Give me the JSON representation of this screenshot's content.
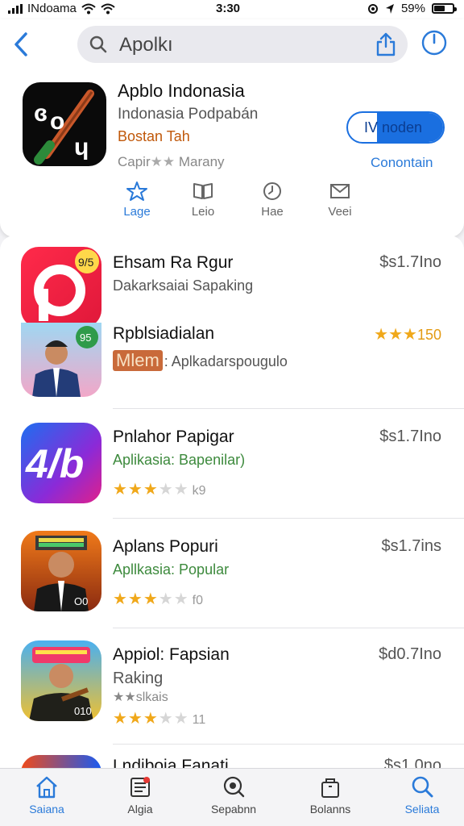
{
  "status": {
    "carrier": "INdoama",
    "time": "3:30",
    "battery": "59%",
    "battery_level": 0.59
  },
  "search": {
    "query": "Apolkı"
  },
  "featured": {
    "title": "Apblo Indonasia",
    "subtitle": "Indonasia Podpabán",
    "tag": "Bostan Tah",
    "rating_prefix": "Capir",
    "rating_stars": "★★",
    "rating_suffix": "Marany",
    "get_label": "IV noden",
    "link": "Conontain",
    "tabs": [
      {
        "label": "Lage",
        "icon": "star-icon"
      },
      {
        "label": "Leio",
        "icon": "book-icon"
      },
      {
        "label": "Hae",
        "icon": "clock-icon"
      },
      {
        "label": "Veei",
        "icon": "mail-icon"
      }
    ]
  },
  "list": [
    {
      "title": "Ehsam Ra Rgur",
      "subtitle": "Dakarksaiai Sapaking",
      "price": "$s1.7Ino",
      "icon_badge": "9/5"
    },
    {
      "title": "Rpblsiadialan",
      "tag": "Mlem",
      "subtitle": ": Aplkadarspougulo",
      "stars": "★★★",
      "count": "150",
      "icon_badge": "95"
    },
    {
      "title": "Pnlahor Papigar",
      "subtitle": "Aplikasia: Bapenilar)",
      "price": "$s1.7Ino",
      "count": "k9",
      "icon_text": "4/b",
      "rating": 3
    },
    {
      "title": "Aplans Popuri",
      "subtitle": "Apllkasia: Popular",
      "price": "$s1.7ins",
      "count": "f0",
      "icon_badge": "O0",
      "rating": 3
    },
    {
      "title": "Appiol: Fapsian",
      "subtitle": "Raking",
      "extra": "★★slkais",
      "price": "$d0.7Ino",
      "count": "11",
      "icon_badge": "010",
      "rating": 3
    },
    {
      "title": "Lndiboia Fanati",
      "price": "$s1.0no"
    }
  ],
  "tabbar": [
    {
      "label": "Saiana",
      "icon": "home-icon",
      "active": true
    },
    {
      "label": "Algia",
      "icon": "news-icon",
      "active": false
    },
    {
      "label": "Sepabnn",
      "icon": "search-target-icon",
      "active": false
    },
    {
      "label": "Bolanns",
      "icon": "bag-icon",
      "active": false
    },
    {
      "label": "Seliata",
      "icon": "search-icon",
      "active": true
    }
  ],
  "colors": {
    "accent": "#2a7ad9",
    "star": "#f0a81a",
    "green": "#3d8a3d"
  }
}
